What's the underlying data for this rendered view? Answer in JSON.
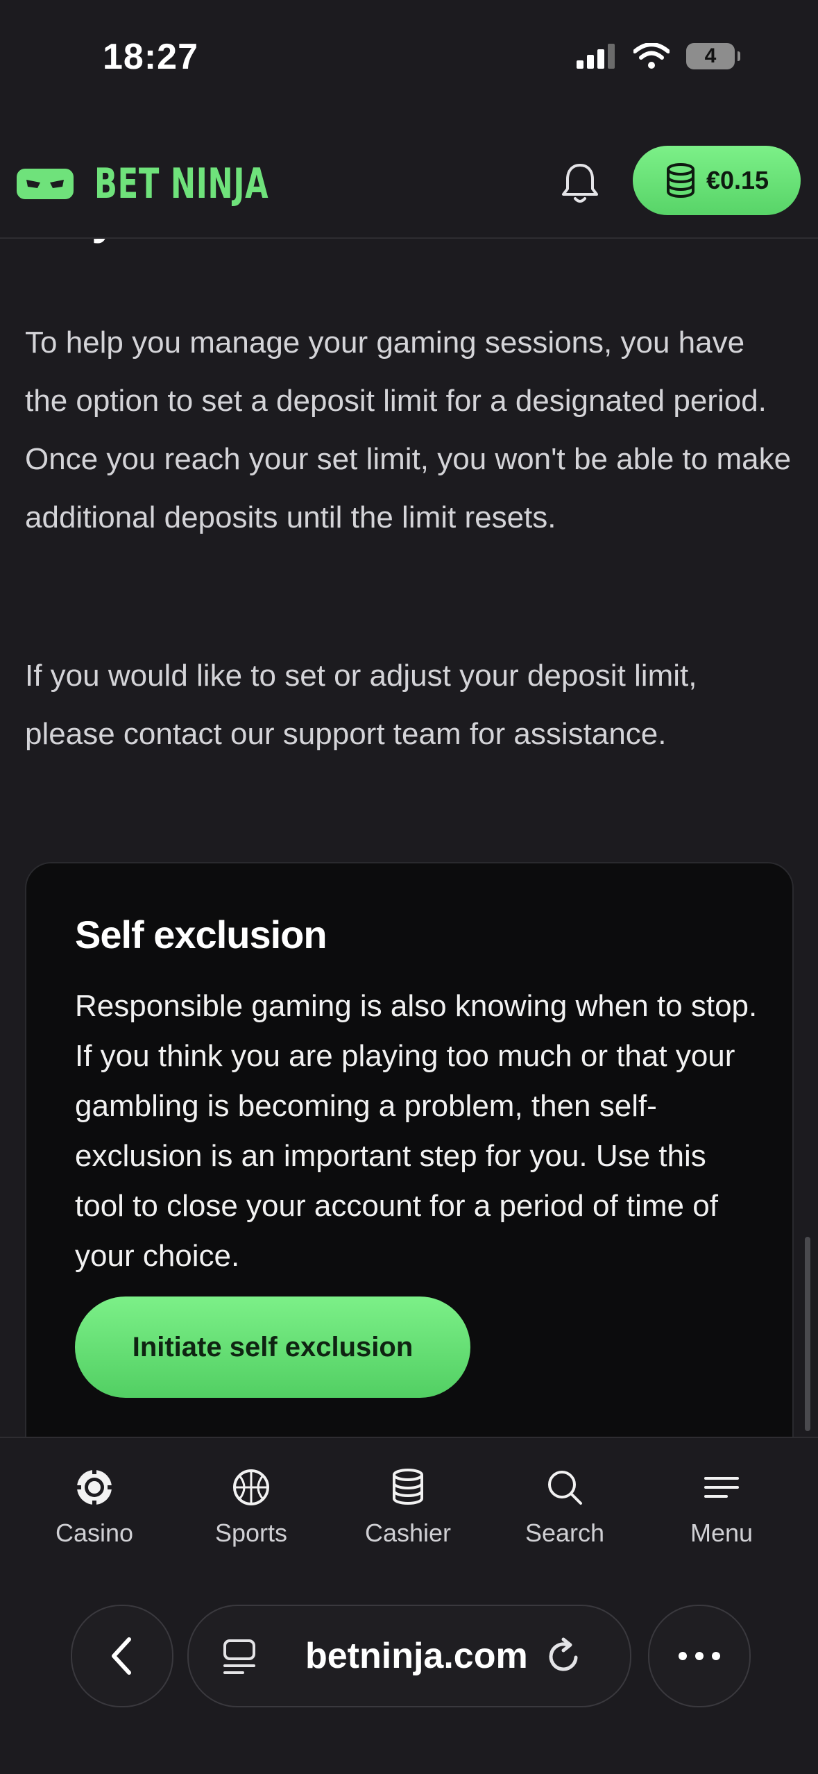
{
  "status_bar": {
    "time": "18:27",
    "battery": "4"
  },
  "header": {
    "logo_text": "BET NINJA",
    "balance": "€0.15"
  },
  "content": {
    "section_heading": "Player Limits",
    "paragraph_1": "To help you manage your gaming sessions, you have the option to set a deposit limit for a designated period. Once you reach your set limit, you won't be able to make additional deposits until the limit resets.",
    "paragraph_2": "If you would like to set or adjust your deposit limit, please contact our support team for assistance.",
    "card": {
      "title": "Self exclusion",
      "text": "Responsible gaming is also knowing when to stop. If you think you are playing too much or that your gambling is becoming a problem, then self-exclusion is an important step for you. Use this tool to close your account for a period of time of your choice.",
      "button": "Initiate self exclusion"
    }
  },
  "bottom_nav": {
    "items": [
      {
        "label": "Casino",
        "icon": "casino-chip-icon"
      },
      {
        "label": "Sports",
        "icon": "basketball-icon"
      },
      {
        "label": "Cashier",
        "icon": "coins-stack-icon"
      },
      {
        "label": "Search",
        "icon": "search-icon"
      },
      {
        "label": "Menu",
        "icon": "menu-icon"
      }
    ]
  },
  "browser": {
    "url": "betninja.com"
  },
  "colors": {
    "accent": "#6fe27b",
    "background": "#1c1b1f",
    "card": "#0c0c0d"
  }
}
